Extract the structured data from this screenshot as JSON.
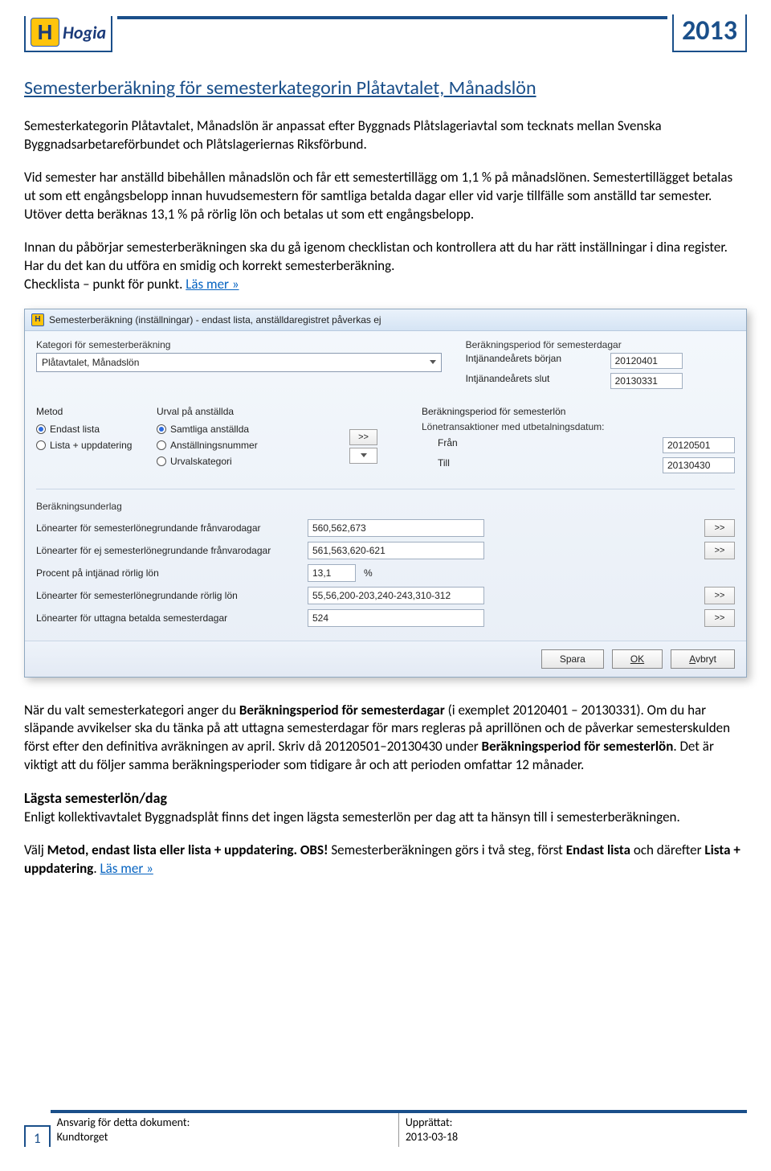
{
  "header": {
    "brand": "Hogia",
    "year": "2013"
  },
  "doc": {
    "title": "Semesterberäkning för semesterkategorin Plåtavtalet, Månadslön",
    "p1": "Semesterkategorin Plåtavtalet, Månadslön är anpassat efter Byggnads Plåtslageriavtal som tecknats mellan Svenska Byggnadsarbetareförbundet och Plåtslageriernas Riksförbund.",
    "p2": "Vid semester har anställd bibehållen månadslön och får ett semestertillägg om 1,1 % på månadslönen. Semestertillägget betalas ut som ett engångsbelopp innan huvudsemestern för samtliga betalda dagar eller vid varje tillfälle som anställd tar semester. Utöver detta beräknas 13,1 % på rörlig lön och betalas ut som ett engångsbelopp.",
    "p3a": "Innan du påbörjar semesterberäkningen ska du gå igenom checklistan och kontrollera att du har rätt inställningar i dina register. Har du det kan du utföra en smidig och korrekt semesterberäkning.",
    "p3b": "Checklista – punkt för punkt. ",
    "p3link": "Läs mer »",
    "after1a": "När du valt semesterkategori anger du ",
    "after1b": "Beräkningsperiod för semesterdagar",
    "after1c": " (i exemplet 20120401 – 20130331). Om du har släpande avvikelser ska du tänka på att uttagna semesterdagar för mars regleras på aprillönen och de påverkar semesterskulden först efter den definitiva avräkningen av april. Skriv då 20120501–20130430 under ",
    "after1d": "Beräkningsperiod för semesterlön",
    "after1e": ". Det är viktigt att du följer samma beräkningsperioder som tidigare år och att perioden omfattar 12 månader.",
    "h2": "Lägsta semesterlön/dag",
    "p4": "Enligt kollektivavtalet Byggnadsplåt finns det ingen lägsta semesterlön per dag att ta hänsyn till i semesterberäkningen.",
    "p5a": "Välj ",
    "p5b": "Metod, endast lista eller lista + uppdatering. OBS!",
    "p5c": " Semesterberäkningen görs i två steg, först ",
    "p5d": "Endast lista",
    "p5e": " och därefter ",
    "p5f": "Lista + uppdatering",
    "p5g": ". ",
    "p5link": "Läs mer »"
  },
  "win": {
    "title": "Semesterberäkning (inställningar) - endast lista, anställdaregistret påverkas ej",
    "kategori_lbl": "Kategori för semesterberäkning",
    "kategori_val": "Plåtavtalet, Månadslön",
    "berper_dag_lbl": "Beräkningsperiod för semesterdagar",
    "intj_borjan_lbl": "Intjänandeårets början",
    "intj_borjan_val": "20120401",
    "intj_slut_lbl": "Intjänandeårets slut",
    "intj_slut_val": "20130331",
    "metod_lbl": "Metod",
    "metod_opts": [
      "Endast lista",
      "Lista + uppdatering"
    ],
    "urval_lbl": "Urval på anställda",
    "urval_opts": [
      "Samtliga anställda",
      "Anställningsnummer",
      "Urvalskategori"
    ],
    "berper_lon_lbl": "Beräkningsperiod för semesterlön",
    "lonetrans_lbl": "Lönetransaktioner med utbetalningsdatum:",
    "fran_lbl": "Från",
    "fran_val": "20120501",
    "till_lbl": "Till",
    "till_val": "20130430",
    "underlag_lbl": "Beräkningsunderlag",
    "rows": [
      {
        "lbl": "Lönearter för semesterlönegrundande frånvarodagar",
        "val": "560,562,673",
        "btn": ">>"
      },
      {
        "lbl": "Lönearter för ej semesterlönegrundande frånvarodagar",
        "val": "561,563,620-621",
        "btn": ">>"
      },
      {
        "lbl": "Procent på intjänad rörlig lön",
        "val": "13,1",
        "pct": "%"
      },
      {
        "lbl": "Lönearter för semesterlönegrundande rörlig lön",
        "val": "55,56,200-203,240-243,310-312",
        "btn": ">>"
      },
      {
        "lbl": "Lönearter för uttagna betalda semesterdagar",
        "val": "524",
        "btn": ">>"
      }
    ],
    "btn_spara": "Spara",
    "btn_ok": "OK",
    "btn_avbryt": "Avbryt",
    "arrow_btn": ">>"
  },
  "footer": {
    "page": "1",
    "left_lbl": "Ansvarig för detta dokument:",
    "left_val": "Kundtorget",
    "right_lbl": "Upprättat:",
    "right_val": "2013-03-18"
  }
}
